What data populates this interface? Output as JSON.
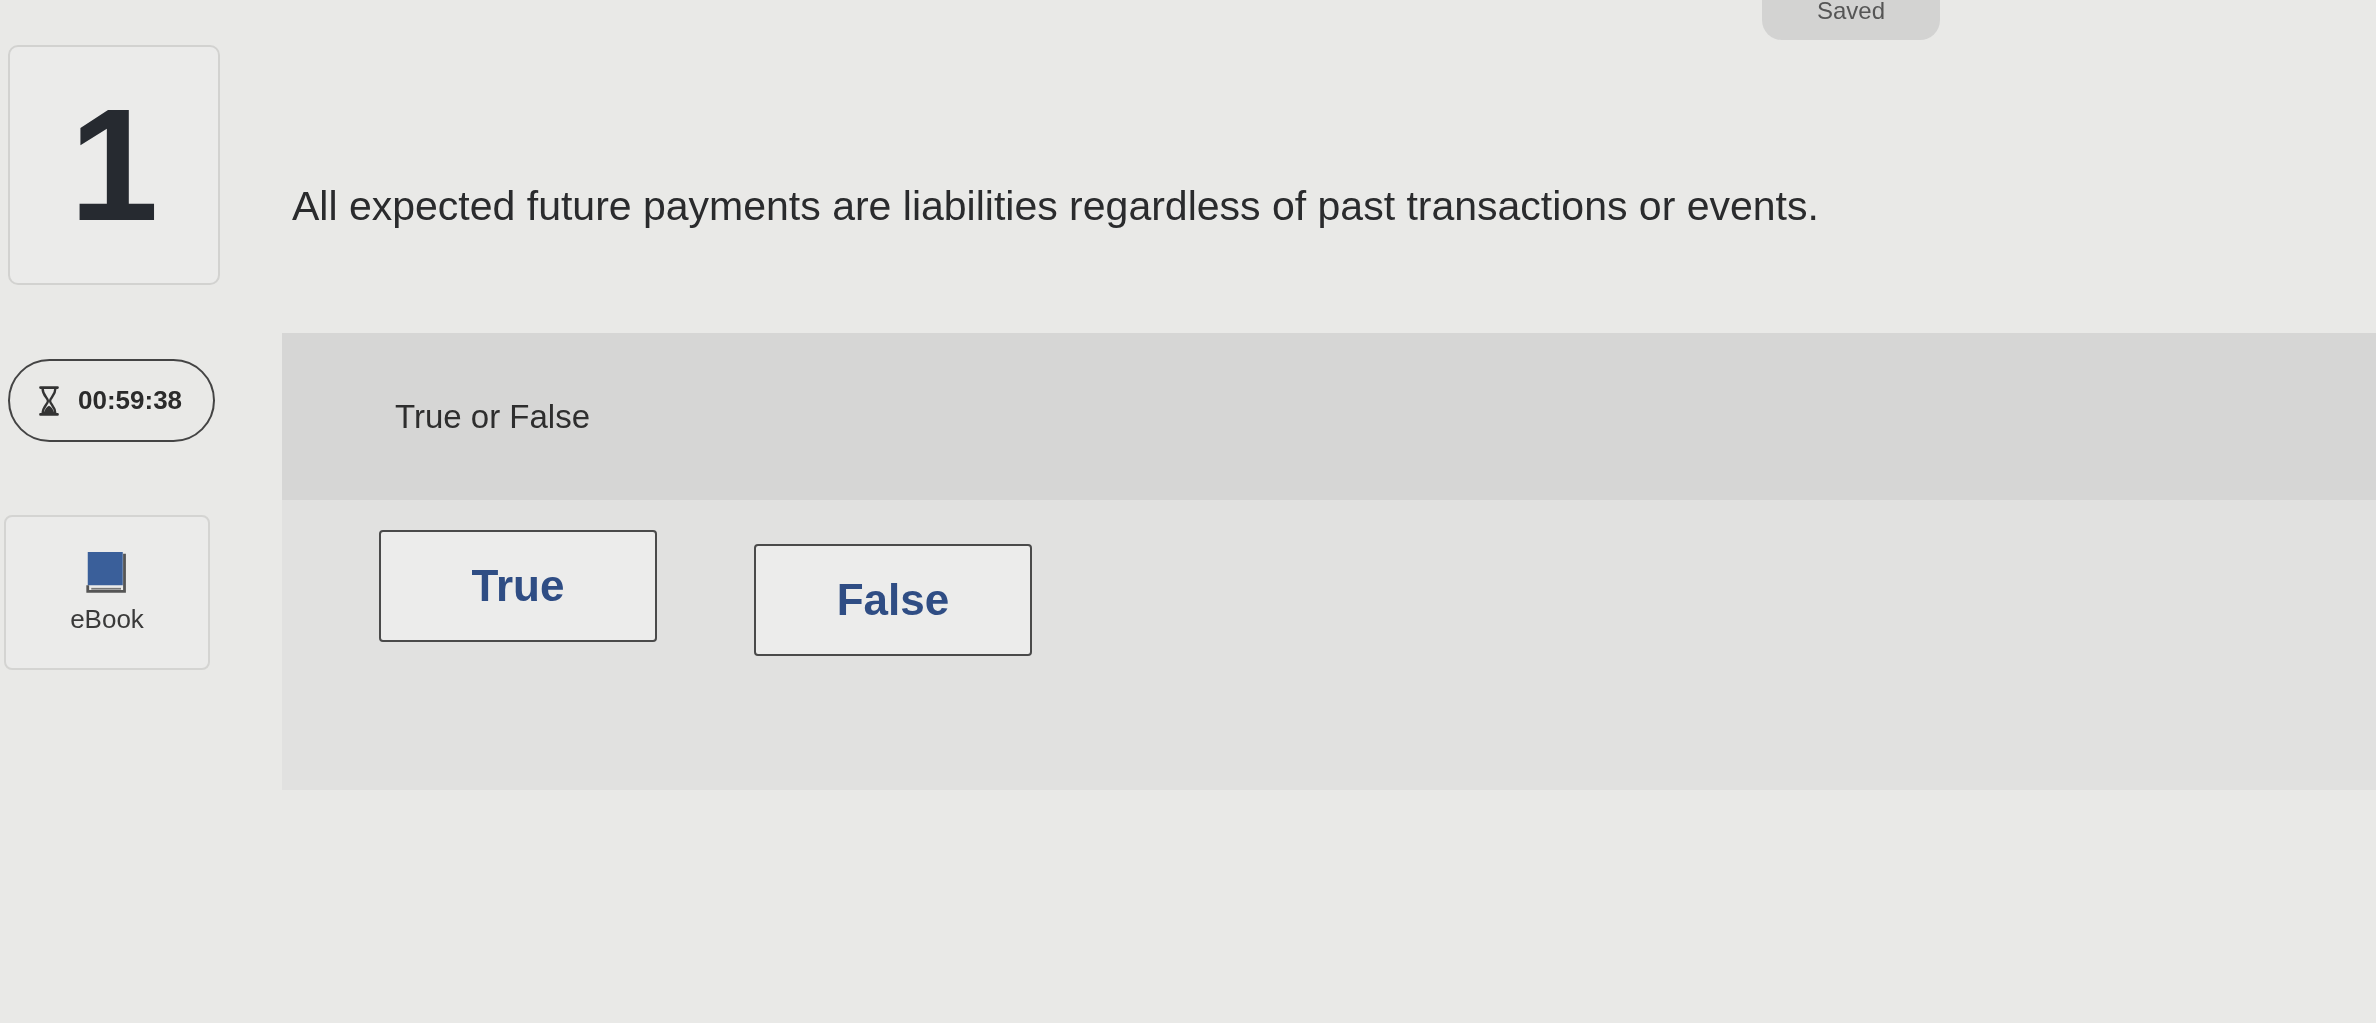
{
  "status": {
    "label": "Saved"
  },
  "question": {
    "number": "1",
    "text": "All expected future payments are liabilities regardless of past transactions or events."
  },
  "timer": {
    "time": "00:59:38"
  },
  "ebook": {
    "label": "eBook"
  },
  "answer": {
    "type_label": "True or False",
    "options": [
      {
        "label": "True",
        "selected": false
      },
      {
        "label": "False",
        "selected": false
      }
    ]
  }
}
